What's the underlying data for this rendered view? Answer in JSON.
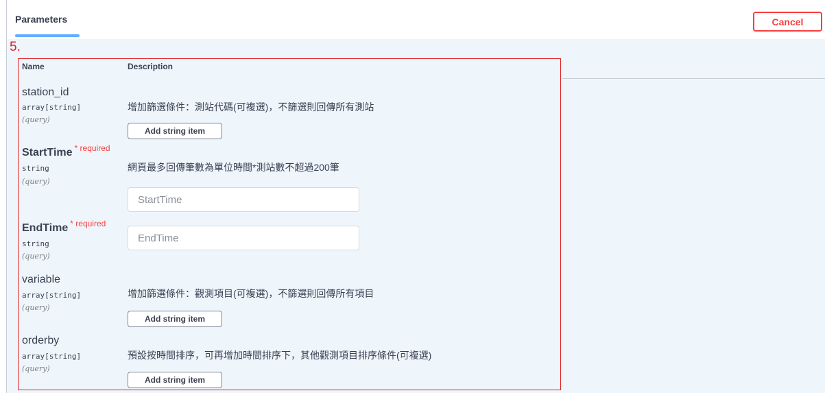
{
  "tabs": {
    "parameters_label": "Parameters"
  },
  "actions": {
    "cancel_label": "Cancel"
  },
  "annotation": {
    "step_label": "5."
  },
  "table": {
    "col_name": "Name",
    "col_description": "Description"
  },
  "params": [
    {
      "name": "station_id",
      "type": "array[string]",
      "in": "(query)",
      "required": false,
      "description": "增加篩選條件：測站代碼(可複選)，不篩選則回傳所有測站",
      "button_label": "Add string item"
    },
    {
      "name": "StartTime",
      "type": "string",
      "in": "(query)",
      "required": true,
      "required_label": "* required",
      "description": "網頁最多回傳筆數為單位時間*測站數不超過200筆",
      "placeholder": "StartTime"
    },
    {
      "name": "EndTime",
      "type": "string",
      "in": "(query)",
      "required": true,
      "required_label": "* required",
      "placeholder": "EndTime"
    },
    {
      "name": "variable",
      "type": "array[string]",
      "in": "(query)",
      "required": false,
      "description": "增加篩選條件：觀測項目(可複選)，不篩選則回傳所有項目",
      "button_label": "Add string item"
    },
    {
      "name": "orderby",
      "type": "array[string]",
      "in": "(query)",
      "required": false,
      "description": "預設按時間排序，可再增加時間排序下，其他觀測項目排序條件(可複選)",
      "button_label": "Add string item"
    }
  ],
  "colors": {
    "accent": "#61affe",
    "danger": "#f93e3e",
    "annotation": "#e02020",
    "background": "#eef5fb"
  }
}
